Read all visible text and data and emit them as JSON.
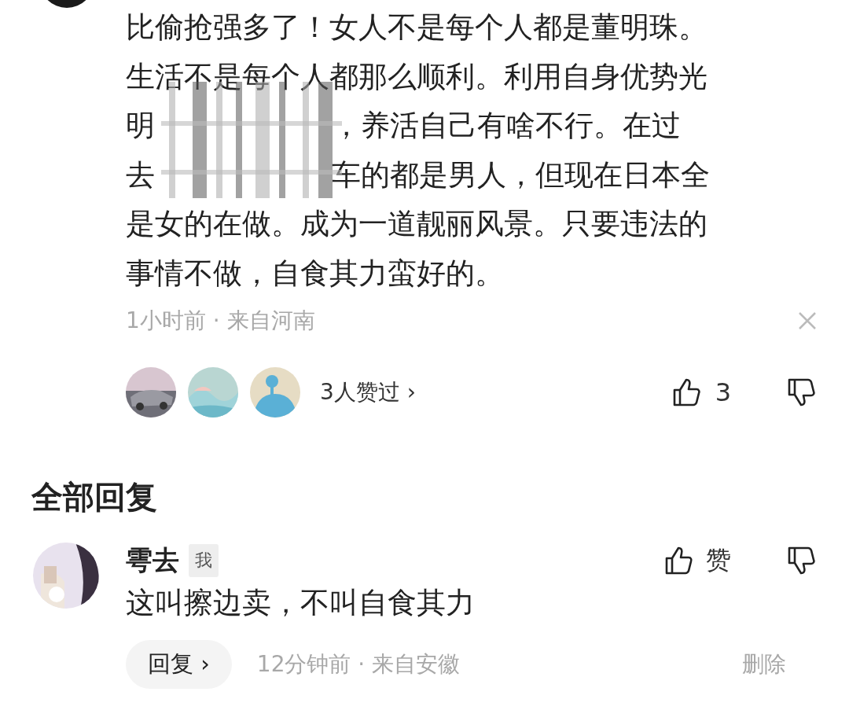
{
  "comment": {
    "lines": [
      {
        "kind": "plain",
        "text": "比偷抢强多了！女人不是每个人都是董明珠。"
      },
      {
        "kind": "plain",
        "text": "生活不是每个人都那么顺利。利用自身优势光"
      },
      {
        "kind": "redacted",
        "before": "明",
        "after": "，养活自己有啥不行。在过"
      },
      {
        "kind": "redacted",
        "before": "去",
        "after": "车的都是男人，但现在日本全"
      },
      {
        "kind": "plain",
        "text": "是女的在做。成为一道靓丽风景。只要违法的"
      },
      {
        "kind": "plain",
        "text": "事情不做，自食其力蛮好的。"
      }
    ],
    "meta": "1小时前 · 来自河南",
    "likers_label": "3人赞过 ›",
    "like_count": "3"
  },
  "replies_heading": "全部回复",
  "replies": [
    {
      "name": "雩去",
      "badge": "我",
      "like_label": "赞",
      "text": "这叫擦边卖，不叫自食其力",
      "reply_button": "回复 ›",
      "meta": "12分钟前 · 来自安徽",
      "delete": "删除"
    }
  ]
}
